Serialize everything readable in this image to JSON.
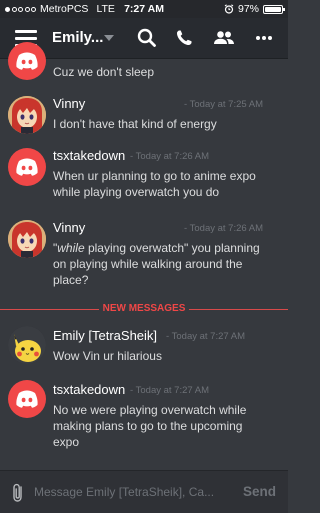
{
  "status_bar": {
    "carrier": "MetroPCS",
    "network": "LTE",
    "time": "7:27 AM",
    "battery": "97%",
    "battery_level": 0.97
  },
  "header": {
    "title": "Emily...",
    "icons": [
      "menu-icon",
      "search-icon",
      "phone-icon",
      "members-icon",
      "more-icon"
    ]
  },
  "messages": [
    {
      "author": "",
      "timestamp": "",
      "lines": [
        "Cuz we don't sleep"
      ],
      "avatar": "discord-default"
    },
    {
      "author": "Vinny",
      "timestamp": "- Today at 7:25 AM",
      "lines": [
        "I don't have that kind of energy"
      ],
      "avatar": "anime-girl"
    },
    {
      "author": "tsxtakedown",
      "timestamp": "- Today at 7:26 AM",
      "lines": [
        "When ur planning to go to anime expo",
        "while playing overwatch you do"
      ],
      "avatar": "discord-default"
    },
    {
      "author": "Vinny",
      "timestamp": "- Today at 7:26 AM",
      "lines_rich": {
        "q1": "\"",
        "italic": "while",
        "rest": " playing overwatch\" you planning"
      },
      "lines": [
        "on playing while walking around the",
        "place?"
      ],
      "avatar": "anime-girl"
    },
    {
      "author": "Emily [TetraSheik]",
      "timestamp": "- Today at 7:27 AM",
      "lines": [
        "Wow Vin ur hilarious"
      ],
      "avatar": "pikachu"
    },
    {
      "author": "tsxtakedown",
      "timestamp": "- Today at 7:27 AM",
      "lines": [
        "No we were playing overwatch while",
        "making plans to go to the upcoming",
        "expo"
      ],
      "avatar": "discord-default"
    }
  ],
  "new_messages_label": "NEW MESSAGES",
  "composer": {
    "placeholder": "Message Emily [TetraSheik], Ca...",
    "send_label": "Send"
  },
  "colors": {
    "background": "#36393e",
    "discord_red": "#f04747",
    "header": "#282b30"
  }
}
